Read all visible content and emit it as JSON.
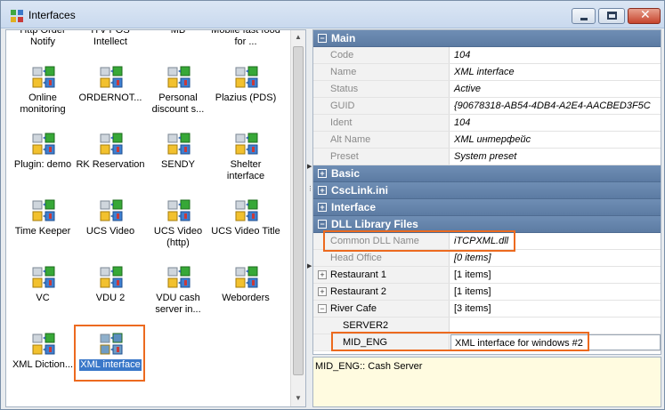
{
  "window": {
    "title": "Interfaces"
  },
  "icons": [
    {
      "label": "Http Order Notify"
    },
    {
      "label": "ITV POS Intellect"
    },
    {
      "label": "MB"
    },
    {
      "label": "Mobile fast food for ..."
    },
    {
      "label": "Online monitoring"
    },
    {
      "label": "ORDERNOT..."
    },
    {
      "label": "Personal discount s..."
    },
    {
      "label": "Plazius (PDS)"
    },
    {
      "label": "Plugin: demo"
    },
    {
      "label": "RK Reservation"
    },
    {
      "label": "SENDY"
    },
    {
      "label": "Shelter interface"
    },
    {
      "label": "Time Keeper"
    },
    {
      "label": "UCS Video"
    },
    {
      "label": "UCS Video (http)"
    },
    {
      "label": "UCS Video Title"
    },
    {
      "label": "VC"
    },
    {
      "label": "VDU 2"
    },
    {
      "label": "VDU cash server in..."
    },
    {
      "label": "Weborders"
    },
    {
      "label": "XML Diction..."
    },
    {
      "label": "XML interface"
    }
  ],
  "properties": {
    "main": {
      "label": "Main",
      "rows": [
        {
          "key": "Code",
          "value": "104"
        },
        {
          "key": "Name",
          "value": "XML interface"
        },
        {
          "key": "Status",
          "value": "Active"
        },
        {
          "key": "GUID",
          "value": "{90678318-AB54-4DB4-A2E4-AACBED3F5C"
        },
        {
          "key": "Ident",
          "value": "104"
        },
        {
          "key": "Alt Name",
          "value": "XML интерфейс"
        },
        {
          "key": "Preset",
          "value": "System preset"
        }
      ]
    },
    "basic": {
      "label": "Basic"
    },
    "csclink": {
      "label": "CscLink.ini"
    },
    "interface": {
      "label": "Interface"
    },
    "dll": {
      "label": "DLL Library Files",
      "common": {
        "key": "Common DLL Name",
        "value": "iTCPXML.dll"
      },
      "head": {
        "key": "Head Office",
        "value": "[0 items]"
      },
      "rest1": {
        "key": "Restaurant 1",
        "value": "[1 items]"
      },
      "rest2": {
        "key": "Restaurant 2",
        "value": "[1 items]"
      },
      "river": {
        "key": "River Cafe",
        "value": "[3 items]"
      },
      "server2": {
        "key": "SERVER2",
        "value": ""
      },
      "mideng": {
        "key": "MID_ENG",
        "value": "XML interface for windows #2"
      }
    }
  },
  "description": "MID_ENG:: Cash Server",
  "colors": {
    "highlight": "#ec6a1f",
    "category": "#5c7ba3",
    "description_bg": "#fffbe0"
  }
}
